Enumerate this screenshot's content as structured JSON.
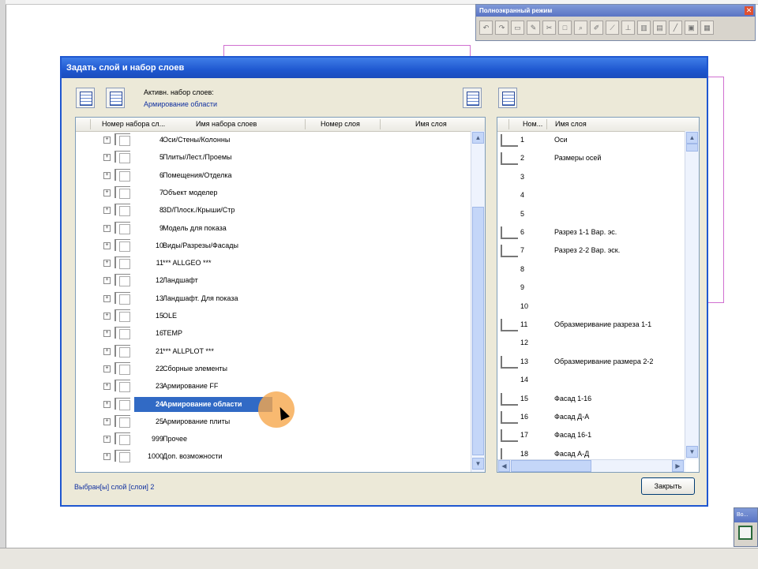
{
  "fullscreen_toolbar": {
    "title": "Полноэкранный режим",
    "close": "✕"
  },
  "mini_window": {
    "title": "Во..."
  },
  "dialog": {
    "title": "Задать слой и набор слоев",
    "active_set_label": "Активн. набор слоев:",
    "active_set_value": "Армирование области",
    "left_headers": {
      "set_number": "Номер набора сл...",
      "set_name": "Имя набора слоев",
      "layer_number": "Номер слоя",
      "layer_name": "Имя слоя"
    },
    "right_headers": {
      "number": "Ном...",
      "name": "Имя слоя"
    },
    "layer_sets": [
      {
        "num": "4",
        "name": "Оси/Стены/Колонны"
      },
      {
        "num": "5",
        "name": "Плиты/Лест./Проемы"
      },
      {
        "num": "6",
        "name": "Помещения/Отделка"
      },
      {
        "num": "7",
        "name": "Объект моделер"
      },
      {
        "num": "8",
        "name": "3D/Плоск./Крыши/Стр"
      },
      {
        "num": "9",
        "name": "Модель для показа"
      },
      {
        "num": "10",
        "name": "Виды/Разрезы/Фасады"
      },
      {
        "num": "11",
        "name": "*** ALLGEO ***"
      },
      {
        "num": "12",
        "name": "Ландшафт"
      },
      {
        "num": "13",
        "name": "Ландшафт. Для показа"
      },
      {
        "num": "15",
        "name": "OLE"
      },
      {
        "num": "16",
        "name": "TEMP"
      },
      {
        "num": "21",
        "name": "*** ALLPLOT ***"
      },
      {
        "num": "22",
        "name": "Сборные элементы"
      },
      {
        "num": "23",
        "name": "Армирование FF"
      },
      {
        "num": "24",
        "name": "Армирование области",
        "selected": true
      },
      {
        "num": "25",
        "name": "Армирование плиты"
      },
      {
        "num": "999",
        "name": "Прочее"
      },
      {
        "num": "1000",
        "name": "Доп. возможности"
      }
    ],
    "layers": [
      {
        "num": "1",
        "name": "Оси",
        "icon": true
      },
      {
        "num": "2",
        "name": "Размеры осей",
        "icon": true
      },
      {
        "num": "3",
        "name": "",
        "icon": false
      },
      {
        "num": "4",
        "name": "",
        "icon": false
      },
      {
        "num": "5",
        "name": "",
        "icon": false
      },
      {
        "num": "6",
        "name": "Разрез 1-1 Вар. эс.",
        "icon": true
      },
      {
        "num": "7",
        "name": "Разрез 2-2 Вар. эск.",
        "icon": true
      },
      {
        "num": "8",
        "name": "",
        "icon": false
      },
      {
        "num": "9",
        "name": "",
        "icon": false
      },
      {
        "num": "10",
        "name": "",
        "icon": false
      },
      {
        "num": "11",
        "name": "Образмеривание разреза 1-1",
        "icon": true
      },
      {
        "num": "12",
        "name": "",
        "icon": false
      },
      {
        "num": "13",
        "name": "Образмеривание размера 2-2",
        "icon": true
      },
      {
        "num": "14",
        "name": "",
        "icon": false
      },
      {
        "num": "15",
        "name": "Фасад 1-16",
        "icon": true
      },
      {
        "num": "16",
        "name": "Фасад Д-А",
        "icon": true
      },
      {
        "num": "17",
        "name": "Фасад 16-1",
        "icon": true
      },
      {
        "num": "18",
        "name": "Фасад А-Д",
        "icon": true
      }
    ],
    "status": "Выбран[ы] слой [слои] 2",
    "close_button": "Закрыть"
  }
}
